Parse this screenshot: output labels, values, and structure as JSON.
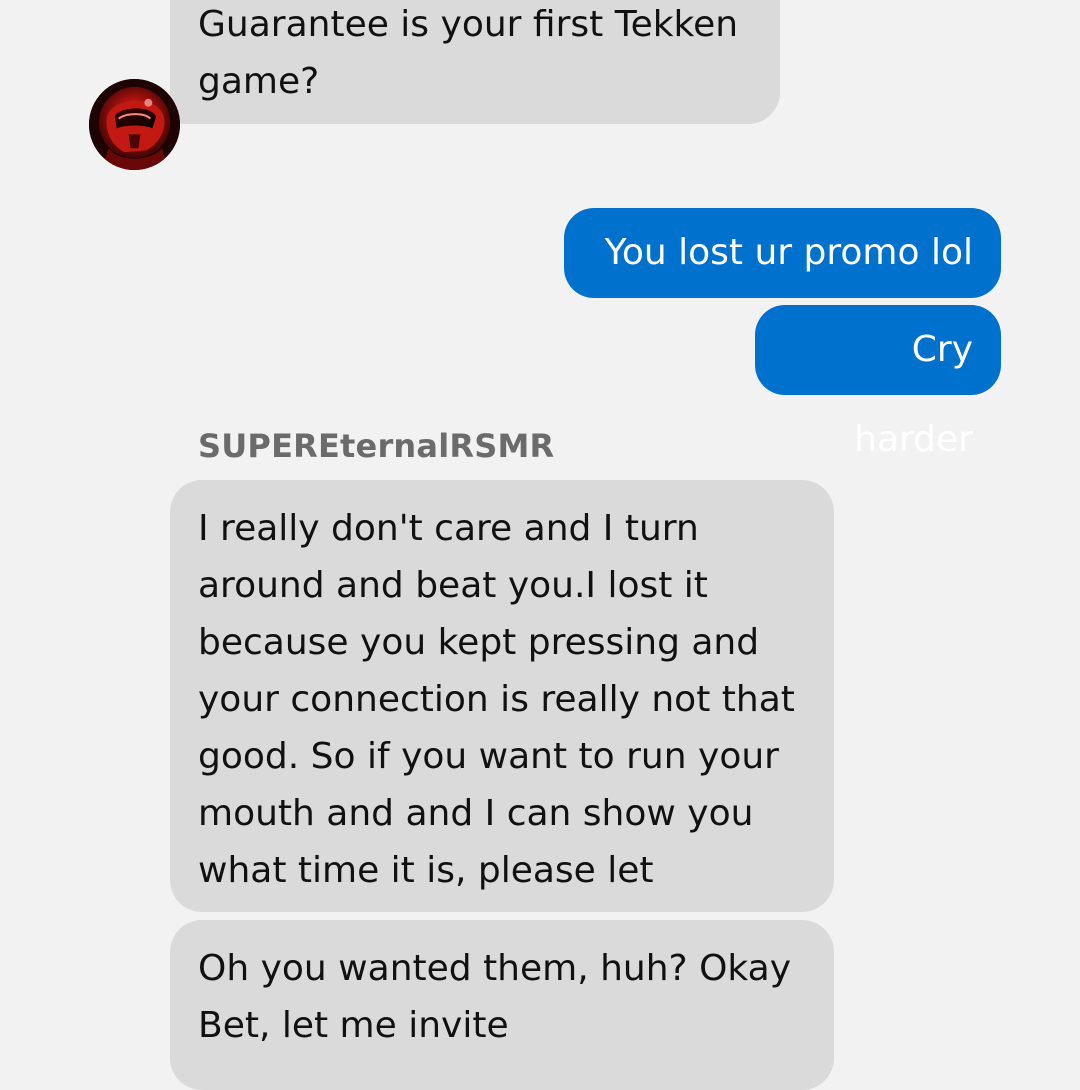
{
  "conversation": {
    "messages": [
      {
        "direction": "incoming",
        "text": "Guarantee is your first Tekken\ngame?"
      },
      {
        "direction": "outgoing",
        "text": "You lost ur promo lol"
      },
      {
        "direction": "outgoing",
        "text": "Cry harder"
      },
      {
        "direction": "incoming",
        "sender": "SUPEREternalRSMR",
        "text": "I really don't care and I turn\naround and beat you.I lost it\nbecause you kept pressing and\nyour connection is really not that\ngood. So if you want to run your\nmouth and and I can show you\nwhat time it is, please let"
      },
      {
        "direction": "incoming",
        "text": "Oh you wanted them, huh? Okay\nBet, let me invite"
      }
    ]
  },
  "colors": {
    "background": "#f2f2f2",
    "incoming_bubble": "#dadada",
    "outgoing_bubble": "#0072ce",
    "sender_name": "#6b6b6b"
  },
  "avatar": {
    "icon": "profile-avatar-red-helmet"
  }
}
